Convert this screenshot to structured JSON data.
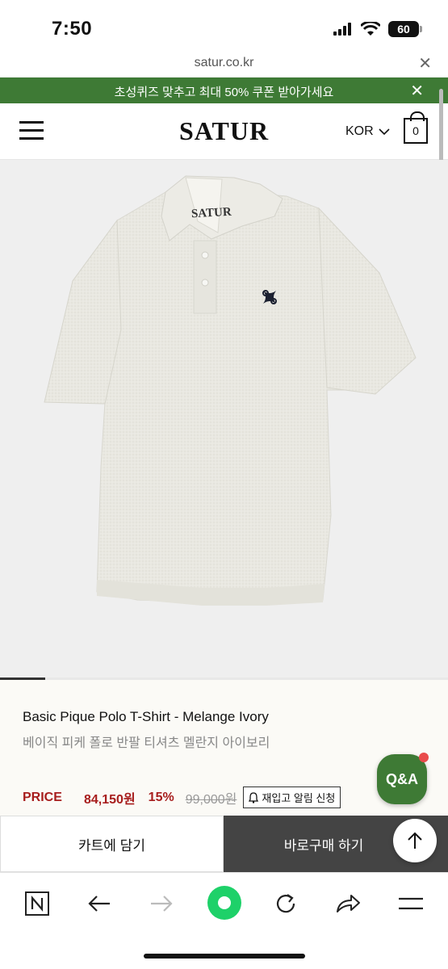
{
  "status_bar": {
    "time": "7:50",
    "battery": "60"
  },
  "url_bar": {
    "url": "satur.co.kr",
    "close": "✕"
  },
  "promo": {
    "text": "초성퀴즈 맞추고 최대 50% 쿠폰 받아가세요",
    "close": "✕"
  },
  "header": {
    "logo": "SATUR",
    "language": "KOR",
    "cart_count": "0"
  },
  "product": {
    "image_icons": [
      "polo-shirt-image"
    ],
    "name_en": "Basic Pique Polo T-Shirt - Melange Ivory",
    "name_ko": "베이직 피케 폴로 반팔 티셔츠 멜란지 아이보리",
    "price_label": "PRICE",
    "sale_price": "84,150원",
    "discount": "15%",
    "original_price": "99,000원",
    "restock_alert": "재입고 알림 신청",
    "label_text": "SATUR"
  },
  "qa_button": "Q&A",
  "actions": {
    "cart": "카트에 담기",
    "buy_now": "바로구매 하기"
  },
  "colors": {
    "brand_green": "#3e7a35",
    "price_red": "#a71d1d",
    "buy_button": "#444444"
  },
  "toolbar": {
    "icons": [
      "naver-home-icon",
      "back-arrow-icon",
      "forward-arrow-icon",
      "green-circle-icon",
      "refresh-icon",
      "share-icon",
      "menu-icon"
    ]
  }
}
